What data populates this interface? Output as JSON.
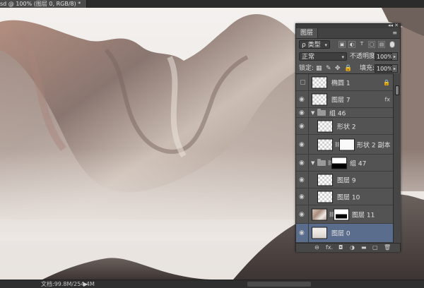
{
  "document_tab": {
    "title": "sd @ 100% (图层 0, RGB/8) *"
  },
  "status": {
    "doc_size": "文档:99.8M/254.4M",
    "arrow": "▶"
  },
  "panel": {
    "tab": "图层",
    "filter": {
      "kind": "ρ 类型"
    },
    "blend_mode": "正常",
    "opacity_label": "不透明度:",
    "opacity": "100%",
    "lock_label": "锁定:",
    "fill_label": "填充:",
    "fill": "100%",
    "layers": [
      {
        "name": "椭圆 1",
        "visible": false,
        "right": "🔒"
      },
      {
        "name": "图层 7",
        "visible": true,
        "right": "fx"
      },
      {
        "name": "组 46",
        "visible": true,
        "type": "group"
      },
      {
        "name": "形状 2",
        "visible": true
      },
      {
        "name": "形状 2 副本",
        "visible": true
      },
      {
        "name": "组 47",
        "visible": true,
        "type": "group"
      },
      {
        "name": "图层 9",
        "visible": true
      },
      {
        "name": "图层 10",
        "visible": true
      },
      {
        "name": "图层 11",
        "visible": true
      },
      {
        "name": "图层 0",
        "visible": true,
        "selected": true
      }
    ],
    "bottom_icons": [
      "link-icon",
      "fx-icon",
      "mask-icon",
      "adjustment-icon",
      "folder-icon",
      "new-layer-icon",
      "trash-icon"
    ]
  },
  "colors": {
    "selected_layer": "#5b6d8d",
    "panel_bg": "#535353"
  }
}
